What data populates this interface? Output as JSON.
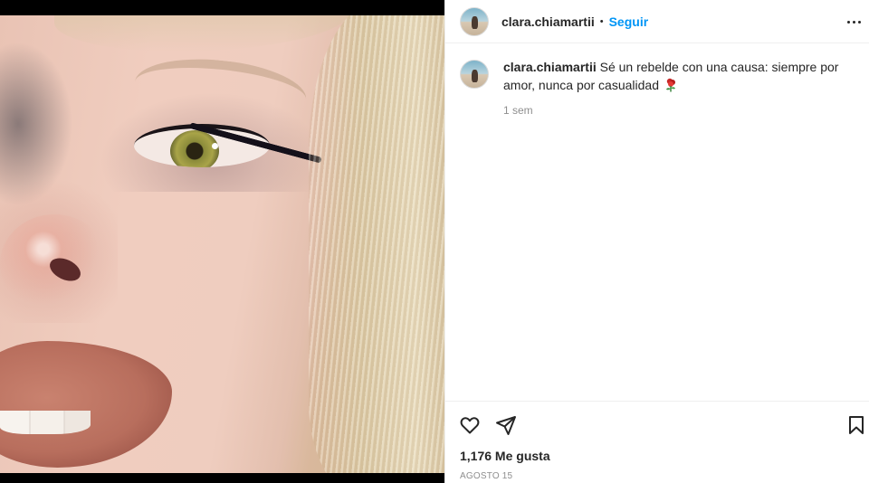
{
  "post": {
    "media_alt": "close-up selfie photo",
    "header": {
      "username": "clara.chiamartii",
      "separator": "•",
      "follow_label": "Seguir",
      "more_icon": "more-horizontal-icon"
    },
    "caption": {
      "username": "clara.chiamartii",
      "text": "Sé un rebelde con una causa: siempre por amor, nunca por casualidad",
      "emoji_icon": "rose-emoji-icon",
      "time": "1 sem"
    },
    "actions": {
      "like_icon": "heart-icon",
      "share_icon": "paper-plane-icon",
      "save_icon": "bookmark-icon"
    },
    "likes": "1,176 Me gusta",
    "date": "AGOSTO 15"
  },
  "colors": {
    "accent": "#0095f6",
    "text": "#262626",
    "muted": "#8e8e8e",
    "border": "#efefef"
  }
}
